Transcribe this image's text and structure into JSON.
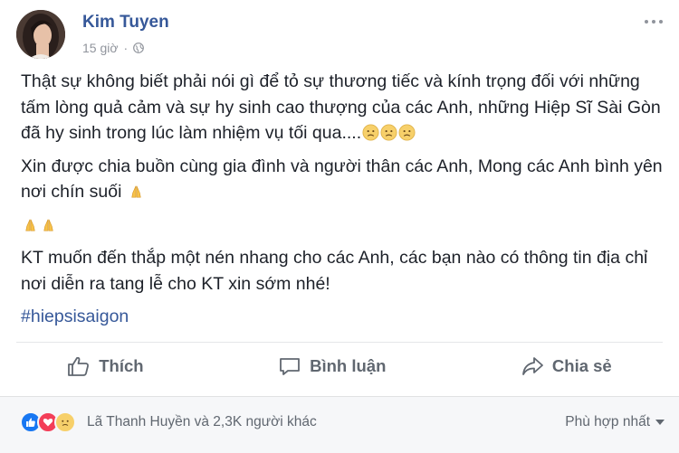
{
  "post": {
    "author": "Kim Tuyen",
    "time": "15 giờ",
    "separator": "·",
    "paragraphs": {
      "p1": "Thật sự không biết phải nói gì để tỏ sự thương tiếc và kính trọng đối với những tấm lòng quả cảm và sự hy sinh cao thượng của các Anh, những Hiệp Sĩ Sài Gòn đã hy sinh trong lúc làm nhiệm vụ tối qua....",
      "p2": "Xin được chia buồn cùng gia đình và người thân các Anh, Mong các Anh bình yên nơi chín suối",
      "p4": "KT muốn đến thắp một nén nhang cho các Anh, các bạn nào có thông tin địa chỉ nơi diễn ra tang lễ cho KT xin sớm nhé!"
    },
    "hashtag": "#hiepsisaigon",
    "icons": {
      "sad_emoji": "sad-face-icon",
      "pray_emoji": "folded-hands-icon",
      "privacy": "globe-icon",
      "more": "more-options-icon"
    }
  },
  "actions": {
    "like": "Thích",
    "comment": "Bình luận",
    "share": "Chia sẻ"
  },
  "reactions": {
    "summary": "Lã Thanh Huyền và 2,3K người khác",
    "sort_label": "Phù hợp nhất",
    "types": [
      "like",
      "love",
      "sad"
    ]
  },
  "colors": {
    "link": "#365899",
    "like_blue": "#1877f2",
    "love_red": "#f33e58",
    "emoji_yellow": "#f7d06a"
  }
}
